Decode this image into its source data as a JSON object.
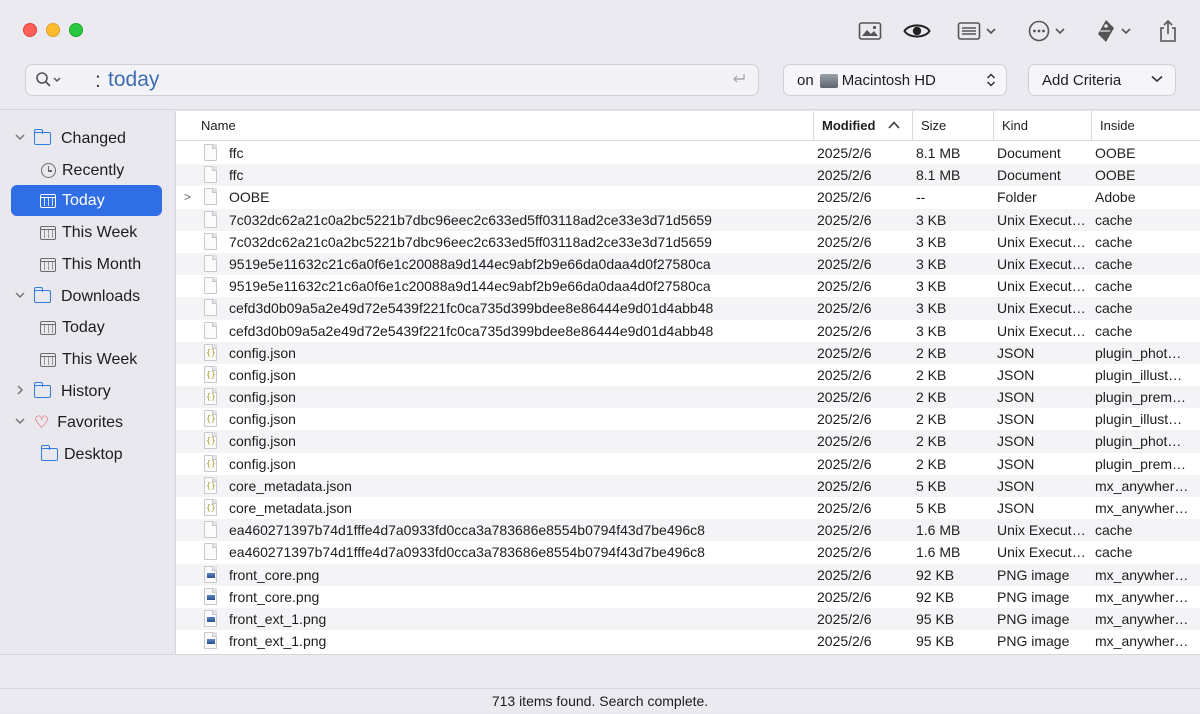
{
  "search": {
    "colon": ":",
    "query": "today"
  },
  "volume": {
    "prefix": "on",
    "name": "Macintosh HD"
  },
  "criteria": {
    "label": "Add Criteria"
  },
  "sidebar": {
    "items": [
      {
        "label": "Changed"
      },
      {
        "label": "Recently"
      },
      {
        "label": "Today"
      },
      {
        "label": "This Week"
      },
      {
        "label": "This Month"
      },
      {
        "label": "Downloads"
      },
      {
        "label": "Today"
      },
      {
        "label": "This Week"
      },
      {
        "label": "History"
      },
      {
        "label": "Favorites"
      },
      {
        "label": "Desktop"
      }
    ]
  },
  "table": {
    "headers": {
      "name": "Name",
      "modified": "Modified",
      "size": "Size",
      "kind": "Kind",
      "inside": "Inside"
    },
    "rows": [
      {
        "name": "ffc",
        "modified": "2025/2/6",
        "size": "8.1 MB",
        "kind": "Document",
        "inside": "OOBE",
        "icon": "doc"
      },
      {
        "name": "ffc",
        "modified": "2025/2/6",
        "size": "8.1 MB",
        "kind": "Document",
        "inside": "OOBE",
        "icon": "doc"
      },
      {
        "name": "OOBE",
        "modified": "2025/2/6",
        "size": "--",
        "kind": "Folder",
        "inside": "Adobe",
        "icon": "doc",
        "disclosure": ">"
      },
      {
        "name": "7c032dc62a21c0a2bc5221b7dbc96eec2c633ed5ff03118ad2ce33e3d71d5659",
        "modified": "2025/2/6",
        "size": "3 KB",
        "kind": "Unix Execut…",
        "inside": "cache",
        "icon": "doc"
      },
      {
        "name": "7c032dc62a21c0a2bc5221b7dbc96eec2c633ed5ff03118ad2ce33e3d71d5659",
        "modified": "2025/2/6",
        "size": "3 KB",
        "kind": "Unix Execut…",
        "inside": "cache",
        "icon": "doc"
      },
      {
        "name": "9519e5e11632c21c6a0f6e1c20088a9d144ec9abf2b9e66da0daa4d0f27580ca",
        "modified": "2025/2/6",
        "size": "3 KB",
        "kind": "Unix Execut…",
        "inside": "cache",
        "icon": "doc"
      },
      {
        "name": "9519e5e11632c21c6a0f6e1c20088a9d144ec9abf2b9e66da0daa4d0f27580ca",
        "modified": "2025/2/6",
        "size": "3 KB",
        "kind": "Unix Execut…",
        "inside": "cache",
        "icon": "doc"
      },
      {
        "name": "cefd3d0b09a5a2e49d72e5439f221fc0ca735d399bdee8e86444e9d01d4abb48",
        "modified": "2025/2/6",
        "size": "3 KB",
        "kind": "Unix Execut…",
        "inside": "cache",
        "icon": "doc"
      },
      {
        "name": "cefd3d0b09a5a2e49d72e5439f221fc0ca735d399bdee8e86444e9d01d4abb48",
        "modified": "2025/2/6",
        "size": "3 KB",
        "kind": "Unix Execut…",
        "inside": "cache",
        "icon": "doc"
      },
      {
        "name": "config.json",
        "modified": "2025/2/6",
        "size": "2 KB",
        "kind": "JSON",
        "inside": "plugin_phot…",
        "icon": "json"
      },
      {
        "name": "config.json",
        "modified": "2025/2/6",
        "size": "2 KB",
        "kind": "JSON",
        "inside": "plugin_illust…",
        "icon": "json"
      },
      {
        "name": "config.json",
        "modified": "2025/2/6",
        "size": "2 KB",
        "kind": "JSON",
        "inside": "plugin_prem…",
        "icon": "json"
      },
      {
        "name": "config.json",
        "modified": "2025/2/6",
        "size": "2 KB",
        "kind": "JSON",
        "inside": "plugin_illust…",
        "icon": "json"
      },
      {
        "name": "config.json",
        "modified": "2025/2/6",
        "size": "2 KB",
        "kind": "JSON",
        "inside": "plugin_phot…",
        "icon": "json"
      },
      {
        "name": "config.json",
        "modified": "2025/2/6",
        "size": "2 KB",
        "kind": "JSON",
        "inside": "plugin_prem…",
        "icon": "json"
      },
      {
        "name": "core_metadata.json",
        "modified": "2025/2/6",
        "size": "5 KB",
        "kind": "JSON",
        "inside": "mx_anywher…",
        "icon": "json"
      },
      {
        "name": "core_metadata.json",
        "modified": "2025/2/6",
        "size": "5 KB",
        "kind": "JSON",
        "inside": "mx_anywher…",
        "icon": "json"
      },
      {
        "name": "ea460271397b74d1fffe4d7a0933fd0cca3a783686e8554b0794f43d7be496c8",
        "modified": "2025/2/6",
        "size": "1.6 MB",
        "kind": "Unix Execut…",
        "inside": "cache",
        "icon": "doc"
      },
      {
        "name": "ea460271397b74d1fffe4d7a0933fd0cca3a783686e8554b0794f43d7be496c8",
        "modified": "2025/2/6",
        "size": "1.6 MB",
        "kind": "Unix Execut…",
        "inside": "cache",
        "icon": "doc"
      },
      {
        "name": "front_core.png",
        "modified": "2025/2/6",
        "size": "92 KB",
        "kind": "PNG image",
        "inside": "mx_anywher…",
        "icon": "png"
      },
      {
        "name": "front_core.png",
        "modified": "2025/2/6",
        "size": "92 KB",
        "kind": "PNG image",
        "inside": "mx_anywher…",
        "icon": "png"
      },
      {
        "name": "front_ext_1.png",
        "modified": "2025/2/6",
        "size": "95 KB",
        "kind": "PNG image",
        "inside": "mx_anywher…",
        "icon": "png"
      },
      {
        "name": "front_ext_1.png",
        "modified": "2025/2/6",
        "size": "95 KB",
        "kind": "PNG image",
        "inside": "mx_anywher…",
        "icon": "png"
      }
    ]
  },
  "status": {
    "text": "713 items found. Search complete."
  },
  "colors": {
    "accent": "#2f6ee5",
    "search_text": "#3f6db3",
    "favorite": "#e0303a",
    "folder": "#2f7de0"
  },
  "icons": [
    "image-icon",
    "eye-icon",
    "list-view-icon",
    "ellipsis-circle-icon",
    "tag-icon",
    "share-icon",
    "search-icon",
    "return-icon",
    "disk-icon"
  ]
}
